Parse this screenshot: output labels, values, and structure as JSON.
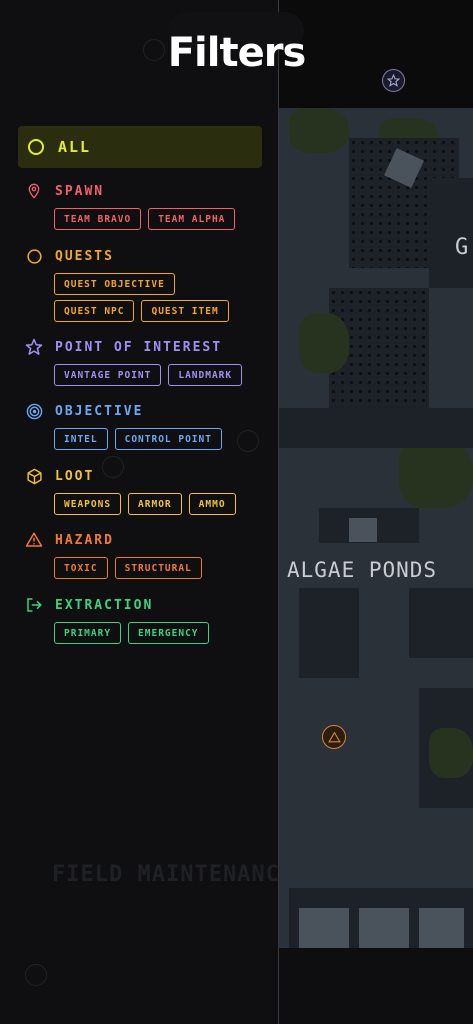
{
  "header": {
    "title": "Filters"
  },
  "map": {
    "labels": {
      "algae_ponds": "ALGAE PONDS",
      "edge_letter": "G",
      "field_maintenance": "FIELD MAINTENANCE"
    }
  },
  "filters": {
    "all": {
      "label": "ALL",
      "color": "#e3ee2c"
    },
    "categories": [
      {
        "key": "spawn",
        "label": "SPAWN",
        "icon": "map-pin-icon",
        "color": "#f0616a",
        "chips": [
          "TEAM BRAVO",
          "TEAM ALPHA"
        ]
      },
      {
        "key": "quests",
        "label": "QUESTS",
        "icon": "circle-icon",
        "color": "#f5a623",
        "chips": [
          "QUEST OBJECTIVE",
          "QUEST NPC",
          "QUEST ITEM"
        ]
      },
      {
        "key": "poi",
        "label": "POINT OF INTEREST",
        "icon": "star-icon",
        "color": "#a28ff5",
        "chips": [
          "VANTAGE POINT",
          "LANDMARK"
        ]
      },
      {
        "key": "objective",
        "label": "OBJECTIVE",
        "icon": "target-icon",
        "color": "#6aa8f2",
        "chips": [
          "INTEL",
          "CONTROL POINT"
        ]
      },
      {
        "key": "loot",
        "label": "LOOT",
        "icon": "box-icon",
        "color": "#f2c230",
        "chips": [
          "WEAPONS",
          "ARMOR",
          "AMMO"
        ]
      },
      {
        "key": "hazard",
        "label": "HAZARD",
        "icon": "warning-triangle-icon",
        "color": "#f07a2e",
        "chips": [
          "TOXIC",
          "STRUCTURAL"
        ]
      },
      {
        "key": "extraction",
        "label": "EXTRACTION",
        "icon": "exit-arrow-icon",
        "color": "#3ed17f",
        "chips": [
          "PRIMARY",
          "EMERGENCY"
        ]
      }
    ]
  }
}
